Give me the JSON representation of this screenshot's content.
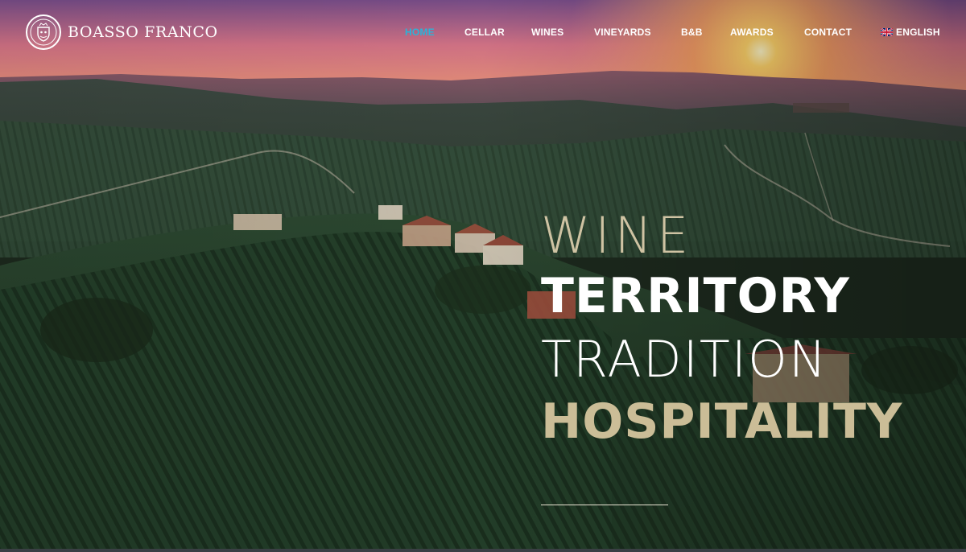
{
  "brand": {
    "name": "BOASSO FRANCO",
    "logo_icon": "crest-icon"
  },
  "nav": {
    "items": [
      {
        "label": "HOME",
        "active": true
      },
      {
        "label": "CELLAR",
        "active": false
      },
      {
        "label": "WINES",
        "active": false
      },
      {
        "label": "VINEYARDS",
        "active": false
      },
      {
        "label": "B&B",
        "active": false
      },
      {
        "label": "AWARDS",
        "active": false
      },
      {
        "label": "CONTACT",
        "active": false
      }
    ],
    "language": {
      "label": "ENGLISH",
      "icon": "uk-flag-icon"
    }
  },
  "hero": {
    "line1": "WINE",
    "line2": "TERRITORY",
    "line3": "TRADITION",
    "line4": "HOSPITALITY"
  },
  "colors": {
    "nav_active": "#2bb3d8",
    "gold": "#cbbd97",
    "white": "#ffffff"
  }
}
